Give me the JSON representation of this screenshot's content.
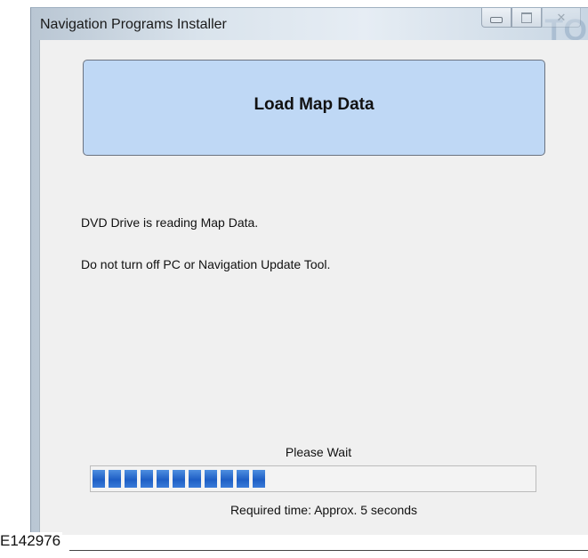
{
  "window": {
    "title": "Navigation Programs Installer",
    "watermark_text": "TO"
  },
  "caption_buttons": {
    "minimize_icon": "minimize-icon",
    "maximize_icon": "maximize-icon",
    "close_icon": "close-icon",
    "close_glyph": "✕"
  },
  "header": {
    "title": "Load Map Data",
    "background_color": "#bfd8f5"
  },
  "messages": {
    "line1": "DVD Drive is reading Map Data.",
    "line2": "Do not turn off PC or Navigation Update Tool."
  },
  "progress": {
    "label": "Please Wait",
    "filled_segments": 11,
    "total_segments": 28,
    "fraction": 0.43,
    "fill_color": "#1f5fc5",
    "required_time": "Required time: Approx. 5 seconds"
  },
  "figure": {
    "id": "E142976"
  }
}
